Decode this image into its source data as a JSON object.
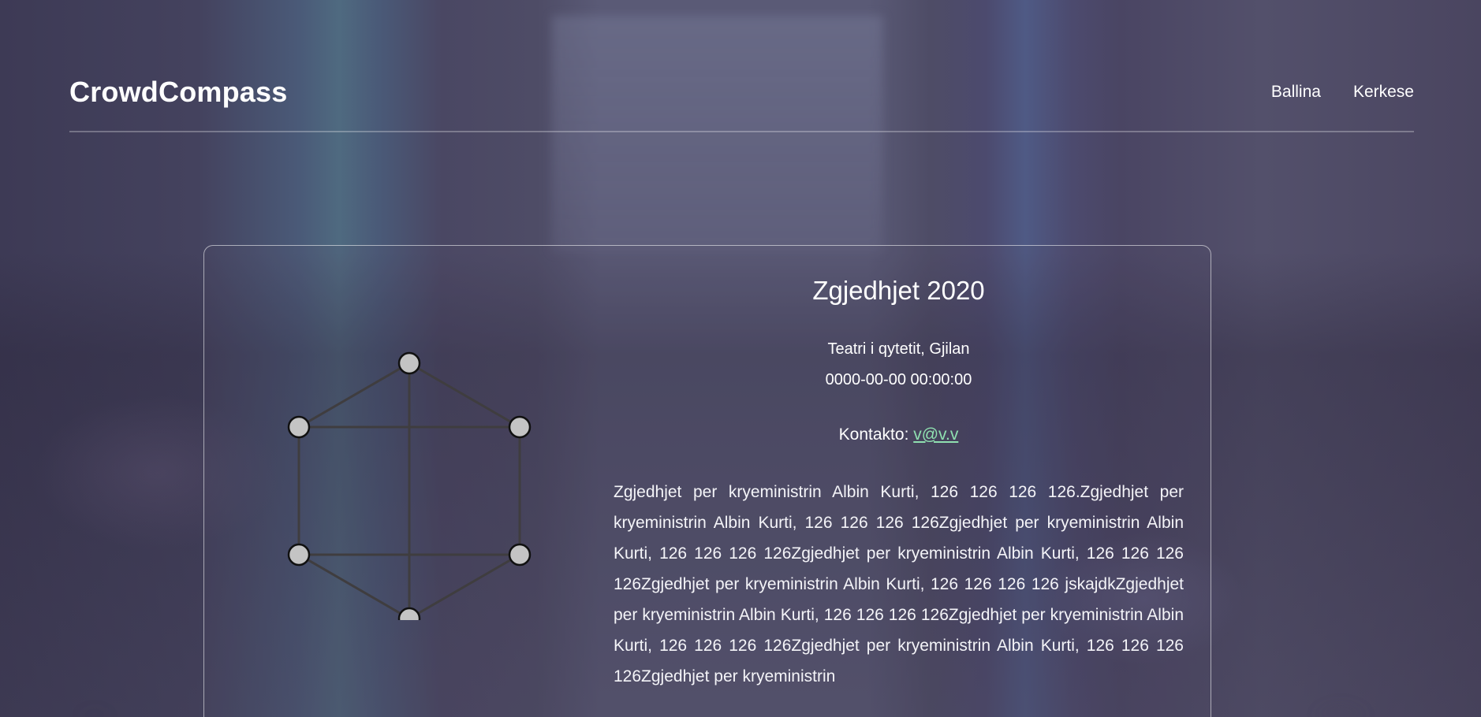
{
  "brand": "CrowdCompass",
  "nav": {
    "home": "Ballina",
    "requests": "Kerkese"
  },
  "event": {
    "title": "Zgjedhjet 2020",
    "venue": "Teatri i qytetit, Gjilan",
    "datetime": "0000-00-00 00:00:00",
    "contact_label": "Kontakto: ",
    "contact_email": "v@v.v",
    "description": "Zgjedhjet per kryeministrin Albin Kurti, 126 126 126 126.Zgjedhjet per kryeministrin Albin Kurti, 126 126 126 126Zgjedhjet per kryeministrin Albin Kurti, 126 126 126 126Zgjedhjet per kryeministrin Albin Kurti, 126 126 126 126Zgjedhjet per kryeministrin Albin Kurti, 126 126 126 126 jskajdkZgjedhjet per kryeministrin Albin Kurti, 126 126 126 126Zgjedhjet per kryeministrin Albin Kurti, 126 126 126 126Zgjedhjet per kryeministrin Albin Kurti, 126 126 126 126Zgjedhjet per kryeministrin"
  },
  "colors": {
    "link": "#8fe0b0",
    "node_fill": "#c4c4c4",
    "edge": "#3f3d3f"
  }
}
